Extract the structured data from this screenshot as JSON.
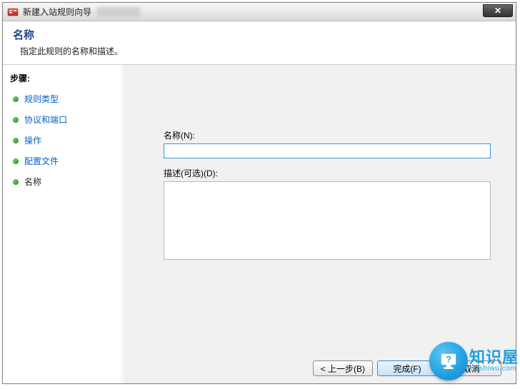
{
  "window": {
    "title": "新建入站规则向导",
    "close_glyph": "✕"
  },
  "header": {
    "title": "名称",
    "subtitle": "指定此规则的名称和描述。"
  },
  "sidebar": {
    "steps_label": "步骤:",
    "items": [
      {
        "label": "规则类型",
        "current": false
      },
      {
        "label": "协议和端口",
        "current": false
      },
      {
        "label": "操作",
        "current": false
      },
      {
        "label": "配置文件",
        "current": false
      },
      {
        "label": "名称",
        "current": true
      }
    ]
  },
  "form": {
    "name_label": "名称(N):",
    "name_value": "",
    "desc_label": "描述(可选)(D):",
    "desc_value": ""
  },
  "footer": {
    "back_label": "< 上一步(B)",
    "finish_label": "完成(F)",
    "cancel_label": "取消"
  },
  "brand": {
    "name": "知识屋",
    "url": "zhishiwu.com",
    "glyph": "?"
  },
  "colors": {
    "accent": "#1f9fe0",
    "link": "#0a60c2",
    "header_title": "#1a4a8a"
  }
}
